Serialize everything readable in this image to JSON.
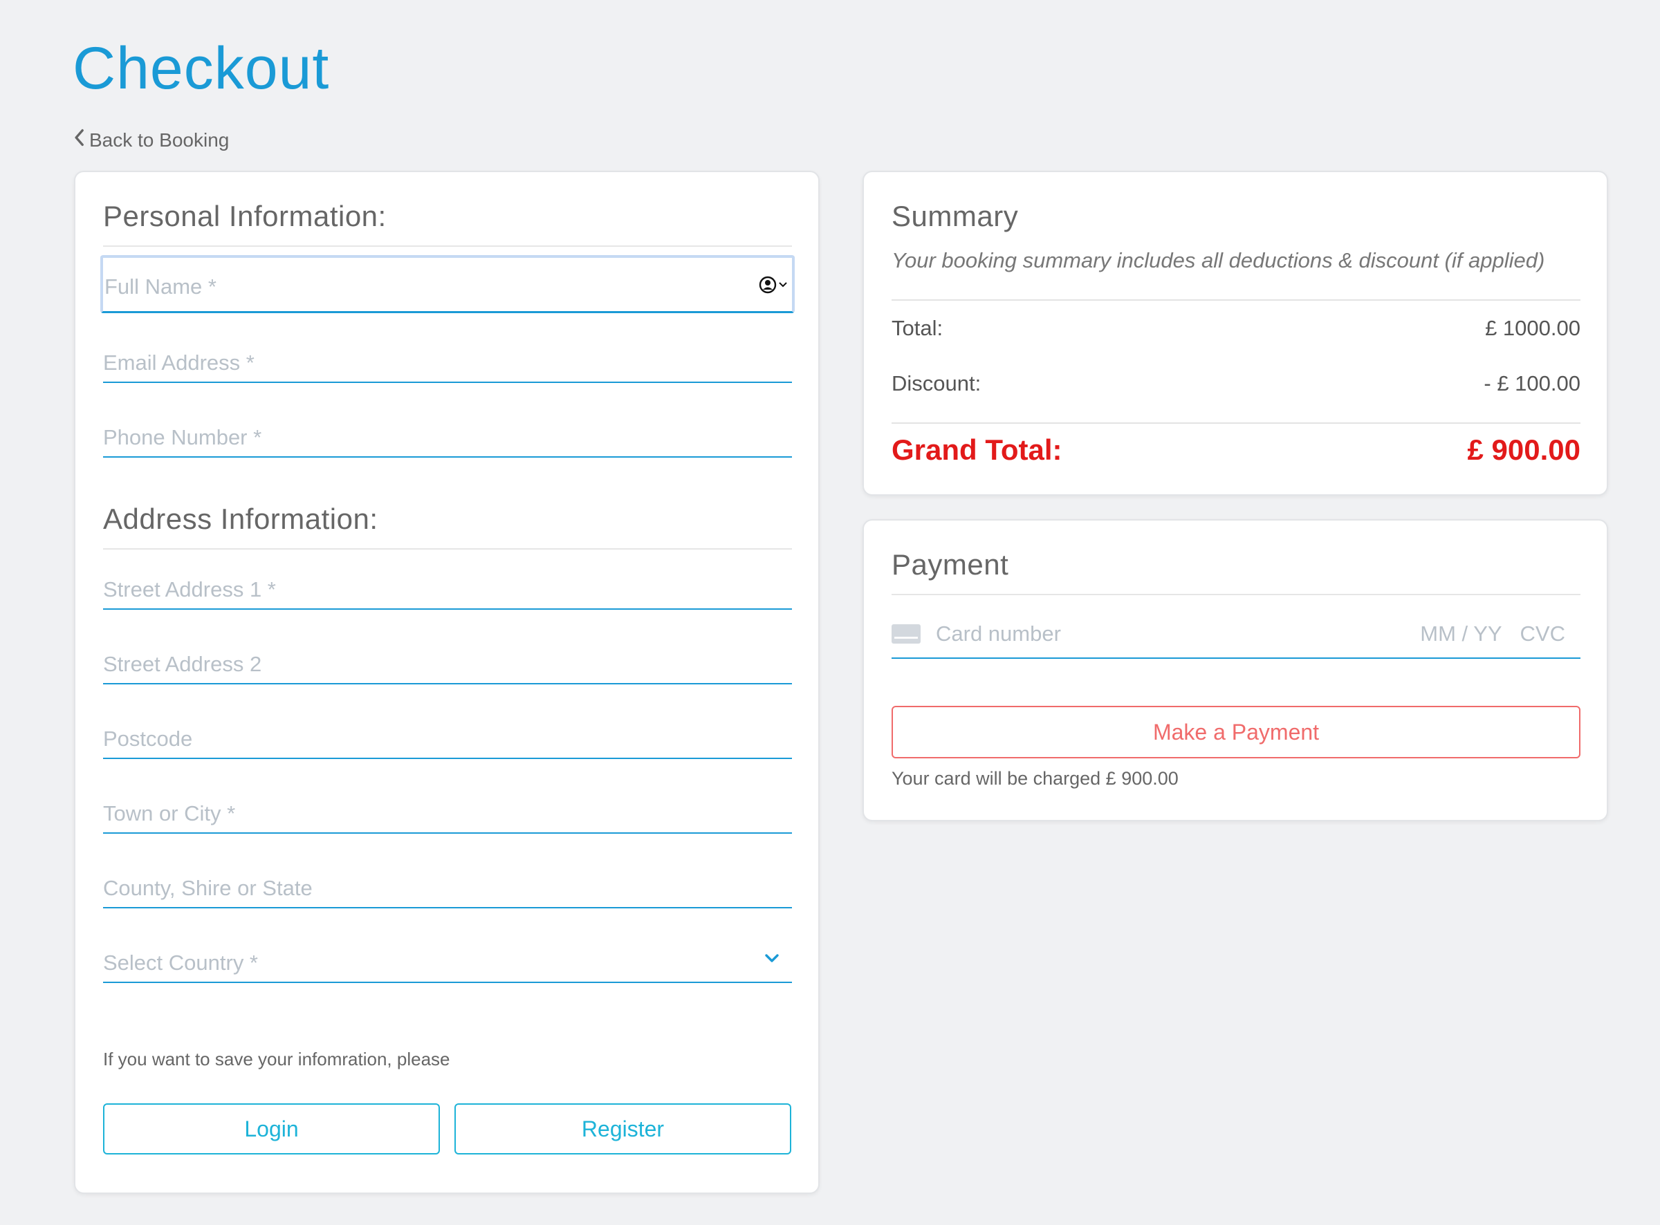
{
  "page": {
    "title": "Checkout",
    "back_link": "Back to Booking"
  },
  "personal": {
    "heading": "Personal Information:",
    "full_name_placeholder": "Full Name *",
    "email_placeholder": "Email Address *",
    "phone_placeholder": "Phone Number *"
  },
  "address": {
    "heading": "Address Information:",
    "street1_placeholder": "Street Address 1 *",
    "street2_placeholder": "Street Address 2",
    "postcode_placeholder": "Postcode",
    "town_placeholder": "Town or City *",
    "county_placeholder": "County, Shire or State",
    "country_placeholder": "Select Country *"
  },
  "account": {
    "prompt": "If you want to save your infomration, please",
    "login_label": "Login",
    "register_label": "Register"
  },
  "summary": {
    "heading": "Summary",
    "subtitle": "Your booking summary includes all deductions & discount (if applied)",
    "total_label": "Total:",
    "total_value": "£ 1000.00",
    "discount_label": "Discount:",
    "discount_value": "- £ 100.00",
    "grand_label": "Grand Total:",
    "grand_value": "£ 900.00"
  },
  "payment": {
    "heading": "Payment",
    "card_placeholder": "Card number",
    "expiry_placeholder": "MM / YY",
    "cvc_placeholder": "CVC",
    "pay_label": "Make a Payment",
    "charge_note": "Your card will be charged £ 900.00"
  },
  "colors": {
    "accent": "#1a9ad6",
    "button_outline": "#1db3d8",
    "pay_button": "#f06b6b",
    "grand_total": "#e21a1a",
    "background": "#f0f1f3"
  }
}
